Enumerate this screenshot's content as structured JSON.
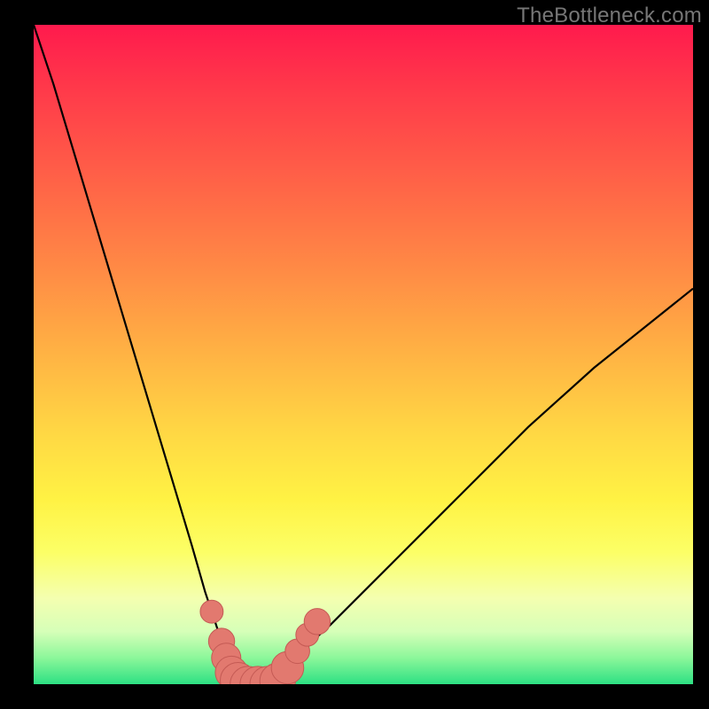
{
  "watermark": "TheBottleneck.com",
  "colors": {
    "frame": "#000000",
    "curve": "#000000",
    "marker_fill": "#e2796f",
    "marker_stroke": "#c45a54",
    "gradient_top": "#ff1a4d",
    "gradient_bottom": "#2de083"
  },
  "chart_data": {
    "type": "line",
    "title": "",
    "xlabel": "",
    "ylabel": "",
    "xlim": [
      0,
      100
    ],
    "ylim": [
      0,
      100
    ],
    "grid": false,
    "legend": false,
    "series": [
      {
        "name": "left-curve",
        "x": [
          0,
          3,
          6,
          9,
          12,
          15,
          18,
          21,
          24,
          26,
          28,
          30,
          31,
          32,
          33
        ],
        "y": [
          100,
          91,
          81,
          71,
          61,
          51,
          41,
          31,
          21,
          14,
          8,
          3,
          1.5,
          0.7,
          0.2
        ]
      },
      {
        "name": "right-curve",
        "x": [
          33,
          35,
          37,
          40,
          45,
          50,
          55,
          60,
          65,
          70,
          75,
          80,
          85,
          90,
          95,
          100
        ],
        "y": [
          0.2,
          0.8,
          2.0,
          4.5,
          9,
          14,
          19,
          24,
          29,
          34,
          39,
          43.5,
          48,
          52,
          56,
          60
        ]
      }
    ],
    "markers": [
      {
        "x": 27.0,
        "y": 11.0,
        "r": 1.0
      },
      {
        "x": 28.5,
        "y": 6.5,
        "r": 1.2
      },
      {
        "x": 29.2,
        "y": 4.0,
        "r": 1.4
      },
      {
        "x": 30.0,
        "y": 1.8,
        "r": 1.6
      },
      {
        "x": 31.0,
        "y": 0.6,
        "r": 1.8
      },
      {
        "x": 32.5,
        "y": 0.0,
        "r": 1.8
      },
      {
        "x": 34.0,
        "y": 0.0,
        "r": 1.8
      },
      {
        "x": 35.5,
        "y": 0.0,
        "r": 1.8
      },
      {
        "x": 37.0,
        "y": 0.5,
        "r": 1.8
      },
      {
        "x": 38.5,
        "y": 2.5,
        "r": 1.6
      },
      {
        "x": 40.0,
        "y": 5.0,
        "r": 1.1
      },
      {
        "x": 41.5,
        "y": 7.5,
        "r": 1.0
      },
      {
        "x": 43.0,
        "y": 9.5,
        "r": 1.2
      }
    ]
  }
}
